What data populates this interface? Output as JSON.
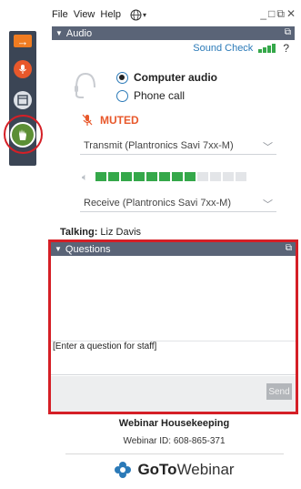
{
  "menu": {
    "file": "File",
    "view": "View",
    "help": "Help"
  },
  "window_controls": {
    "minimize": "_",
    "restore": "□",
    "popout": "⧉",
    "close": "✕"
  },
  "audio_panel": {
    "title": "Audio",
    "sound_check": "Sound Check",
    "help": "?",
    "options": [
      {
        "label": "Computer audio",
        "selected": true
      },
      {
        "label": "Phone call",
        "selected": false
      }
    ],
    "mute_status": "MUTED",
    "transmit_device": "Transmit (Plantronics Savi 7xx-M)",
    "receive_device": "Receive (Plantronics Savi 7xx-M)",
    "speaker_level": {
      "active_segments": 8,
      "total_segments": 12
    },
    "colors": {
      "active": "#35a84a",
      "inactive": "#e3e5e8",
      "muted": "#e8582b",
      "link": "#2b7ab8"
    }
  },
  "talking": {
    "label": "Talking:",
    "name": "Liz Davis"
  },
  "questions_panel": {
    "title": "Questions",
    "input_placeholder": "[Enter a question for staff]",
    "send_label": "Send",
    "highlight_color": "#d51f26"
  },
  "webinar": {
    "title": "Webinar Housekeeping",
    "id_text": "Webinar ID: 608-865-371"
  },
  "brand": {
    "goto": "GoTo",
    "webinar": "Webinar"
  },
  "toolbar": {
    "icons": [
      "arrow-right-icon",
      "microphone-icon",
      "screen-icon",
      "raise-hand-icon"
    ],
    "accent": "#f07c21"
  }
}
